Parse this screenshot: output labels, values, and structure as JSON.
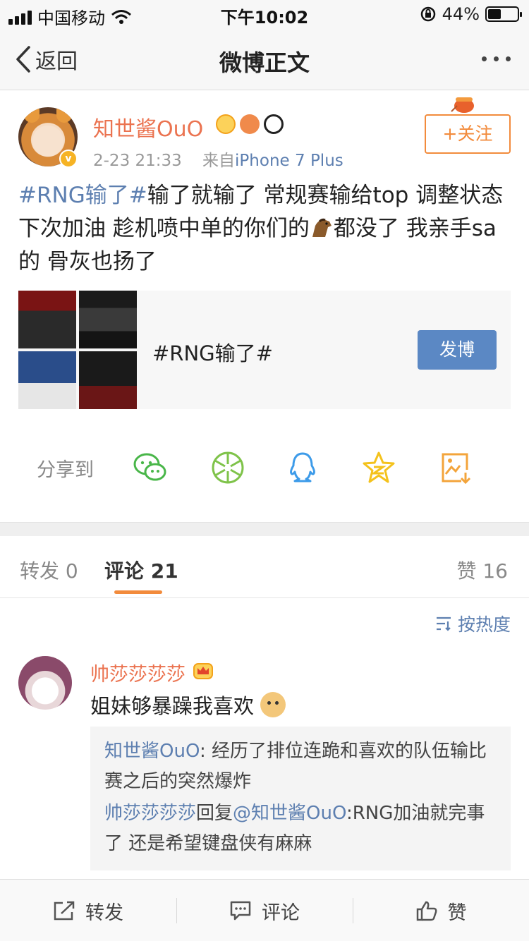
{
  "status_bar": {
    "carrier": "中国移动",
    "time": "下午10:02",
    "battery": "44%",
    "battery_level": 0.44
  },
  "nav": {
    "back_label": "返回",
    "title": "微博正文"
  },
  "post": {
    "author": "知世酱OuO",
    "timestamp": "2-23 21:33",
    "source_prefix": "来自",
    "source": "iPhone 7 Plus",
    "follow_label": "+关注",
    "hashtag": "#RNG输了#",
    "text_line1": "输了就输了 常规赛输给top 调整状态下次加油 趁机喷中单的你们的",
    "text_line2": "都没了 我亲手sa的 骨灰也扬了"
  },
  "topic_card": {
    "title": "#RNG输了#",
    "button_label": "发博"
  },
  "share": {
    "label": "分享到",
    "targets": [
      "wechat-icon",
      "moments-icon",
      "qq-icon",
      "qzone-icon",
      "save-image-icon"
    ]
  },
  "tabs": {
    "repost_label": "转发",
    "repost_count": "0",
    "comment_label": "评论",
    "comment_count": "21",
    "like_label": "赞",
    "like_count": "16"
  },
  "sort_label": "按热度",
  "comment": {
    "name": "帅莎莎莎莎",
    "text": "姐妹够暴躁我喜欢",
    "replies": [
      {
        "name": "知世酱OuO",
        "sep": ": ",
        "text": "经历了排位连跪和喜欢的队伍输比赛之后的突然爆炸"
      },
      {
        "name": "帅莎莎莎莎",
        "mid": "回复",
        "mention": "@知世酱OuO",
        "text": ":RNG加油就完事了 还是希望键盘侠有麻麻"
      }
    ]
  },
  "bottom_bar": {
    "repost": "转发",
    "comment": "评论",
    "like": "赞"
  },
  "colors": {
    "name_orange": "#eb7350",
    "link_blue": "#5d7fb0",
    "follow_orange": "#f28b3c",
    "post_button_blue": "#5b88c4"
  }
}
